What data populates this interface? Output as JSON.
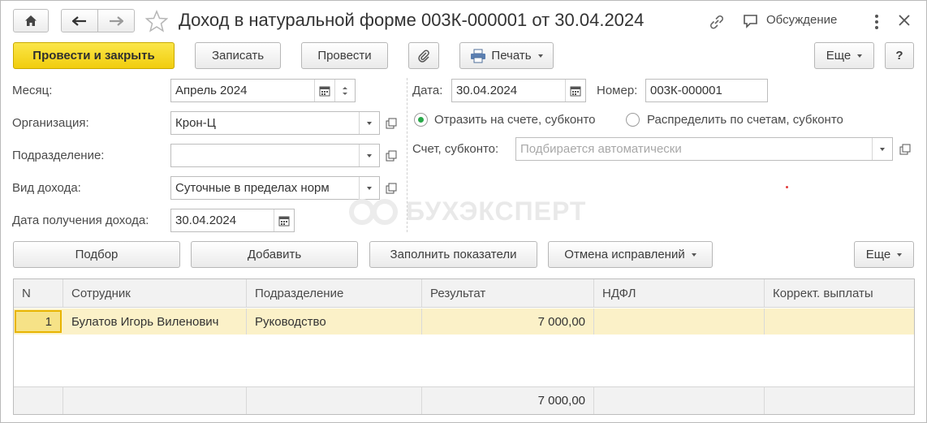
{
  "window": {
    "title": "Доход в натуральной форме 003К-000001 от 30.04.2024",
    "discussion_label": "Обсуждение"
  },
  "toolbar": {
    "post_close": "Провести и закрыть",
    "save": "Записать",
    "post": "Провести",
    "print": "Печать",
    "more": "Еще",
    "help": "?"
  },
  "form": {
    "month": {
      "label": "Месяц:",
      "value": "Апрель 2024"
    },
    "organization": {
      "label": "Организация:",
      "value": "Крон-Ц"
    },
    "department": {
      "label": "Подразделение:",
      "value": ""
    },
    "income_type": {
      "label": "Вид дохода:",
      "value": "Суточные в пределах норм"
    },
    "income_date": {
      "label": "Дата получения дохода:",
      "value": "30.04.2024"
    },
    "date": {
      "label": "Дата:",
      "value": "30.04.2024"
    },
    "number": {
      "label": "Номер:",
      "value": "003К-000001"
    },
    "radio_reflect": {
      "label": "Отразить на счете, субконто",
      "checked": true
    },
    "radio_distribute": {
      "label": "Распределить по счетам, субконто",
      "checked": false
    },
    "account": {
      "label": "Счет, субконто:",
      "placeholder": "Подбирается автоматически"
    }
  },
  "table_toolbar": {
    "pick": "Подбор",
    "add": "Добавить",
    "fill": "Заполнить показатели",
    "cancel_corrections": "Отмена исправлений",
    "more": "Еще"
  },
  "table": {
    "columns": [
      "N",
      "Сотрудник",
      "Подразделение",
      "Результат",
      "НДФЛ",
      "Коррект. выплаты"
    ],
    "rows": [
      {
        "n": "1",
        "employee": "Булатов Игорь Виленович",
        "department": "Руководство",
        "result": "7 000,00",
        "ndfl": "",
        "correction": ""
      }
    ],
    "totals": {
      "result": "7 000,00"
    }
  },
  "watermark": "БУХЭКСПЕРТ"
}
